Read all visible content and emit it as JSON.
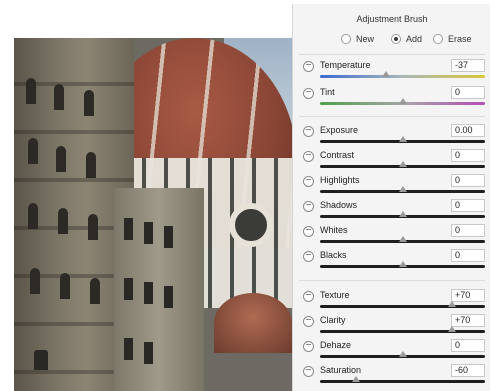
{
  "panel": {
    "title": "Adjustment Brush",
    "modes": [
      {
        "label": "New",
        "selected": false
      },
      {
        "label": "Add",
        "selected": true
      },
      {
        "label": "Erase",
        "selected": false
      }
    ],
    "sliders": [
      {
        "name": "Temperature",
        "value": "-37",
        "level": 0.4
      },
      {
        "name": "Tint",
        "value": "0",
        "level": 0.5
      },
      {
        "name": "Exposure",
        "value": "0.00",
        "level": 0.5
      },
      {
        "name": "Contrast",
        "value": "0",
        "level": 0.5
      },
      {
        "name": "Highlights",
        "value": "0",
        "level": 0.5
      },
      {
        "name": "Shadows",
        "value": "0",
        "level": 0.5
      },
      {
        "name": "Whites",
        "value": "0",
        "level": 0.5
      },
      {
        "name": "Blacks",
        "value": "0",
        "level": 0.5
      },
      {
        "name": "Texture",
        "value": "+70",
        "level": 0.8
      },
      {
        "name": "Clarity",
        "value": "+70",
        "level": 0.8
      },
      {
        "name": "Dehaze",
        "value": "0",
        "level": 0.5
      },
      {
        "name": "Saturation",
        "value": "-60",
        "level": 0.22
      }
    ]
  },
  "photo": {
    "subject": "Florence cathedral dome"
  },
  "colors": {
    "panel_bg": "#f4f4f4",
    "track_dark": "#1f1f1f"
  }
}
